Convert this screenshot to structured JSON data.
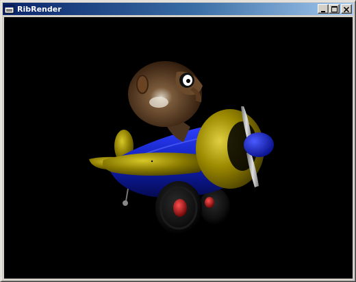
{
  "window": {
    "title": "RibRender",
    "icon": "app-window-icon",
    "controls": {
      "minimize_icon": "minimize-icon",
      "maximize_icon": "maximize-icon",
      "close_icon": "close-icon"
    }
  },
  "viewport": {
    "background": "#000000",
    "scene": "rendered-3d-toy-airplane-with-pilot"
  },
  "colors": {
    "title_active": "#0a246a",
    "title_gradient_end": "#a6caf0",
    "face": "#d4d0c8",
    "plane_body": "#1a2bd0",
    "plane_wing": "#8a7a00",
    "pilot_helmet": "#5a3a1e",
    "wheel_hub": "#c01010"
  }
}
